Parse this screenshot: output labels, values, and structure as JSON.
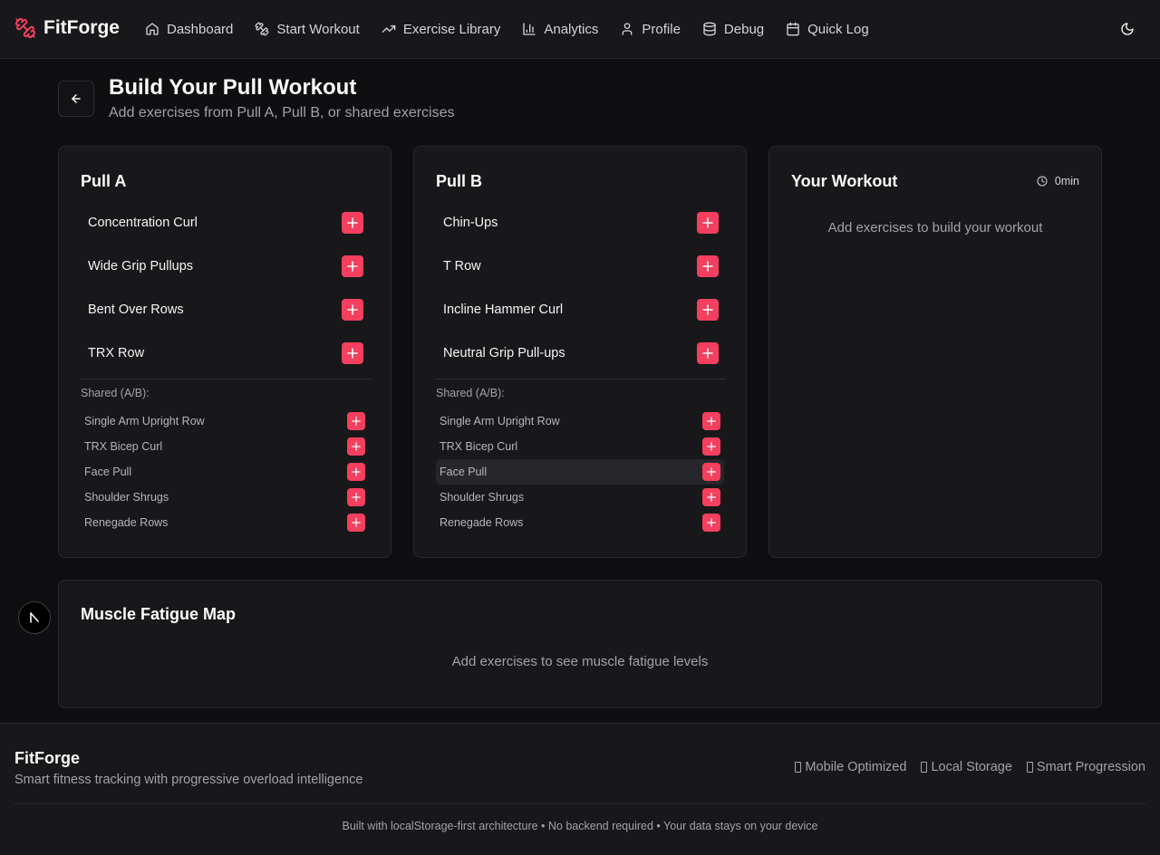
{
  "nav": {
    "brand": "FitForge",
    "items": [
      {
        "label": "Dashboard",
        "icon": "home-icon"
      },
      {
        "label": "Start Workout",
        "icon": "dumbbell-icon"
      },
      {
        "label": "Exercise Library",
        "icon": "trending-up-icon"
      },
      {
        "label": "Analytics",
        "icon": "bar-chart-icon"
      },
      {
        "label": "Profile",
        "icon": "user-icon"
      },
      {
        "label": "Debug",
        "icon": "database-icon"
      },
      {
        "label": "Quick Log",
        "icon": "calendar-icon"
      }
    ],
    "theme_icon": "moon-icon"
  },
  "header": {
    "title": "Build Your Pull Workout",
    "subtitle": "Add exercises from Pull A, Pull B, or shared exercises"
  },
  "pull_a": {
    "title": "Pull A",
    "exercises": [
      "Concentration Curl",
      "Wide Grip Pullups",
      "Bent Over Rows",
      "TRX Row"
    ],
    "shared_label": "Shared (A/B):",
    "shared": [
      "Single Arm Upright Row",
      "TRX Bicep Curl",
      "Face Pull",
      "Shoulder Shrugs",
      "Renegade Rows"
    ]
  },
  "pull_b": {
    "title": "Pull B",
    "exercises": [
      "Chin-Ups",
      "T Row",
      "Incline Hammer Curl",
      "Neutral Grip Pull-ups"
    ],
    "shared_label": "Shared (A/B):",
    "shared": [
      "Single Arm Upright Row",
      "TRX Bicep Curl",
      "Face Pull",
      "Shoulder Shrugs",
      "Renegade Rows"
    ]
  },
  "workout": {
    "title": "Your Workout",
    "duration": "0min",
    "empty": "Add exercises to build your workout"
  },
  "fatigue": {
    "title": "Muscle Fatigue Map",
    "empty": "Add exercises to see muscle fatigue levels"
  },
  "footer": {
    "brand": "FitForge",
    "tagline": "Smart fitness tracking with progressive overload intelligence",
    "features": [
      "Mobile Optimized",
      "Local Storage",
      "Smart Progression"
    ],
    "note": "Built with localStorage-first architecture • No backend required • Your data stays on your device"
  },
  "colors": {
    "accent": "#f43f5e",
    "background": "#0f0f11",
    "surface": "#18181b"
  }
}
